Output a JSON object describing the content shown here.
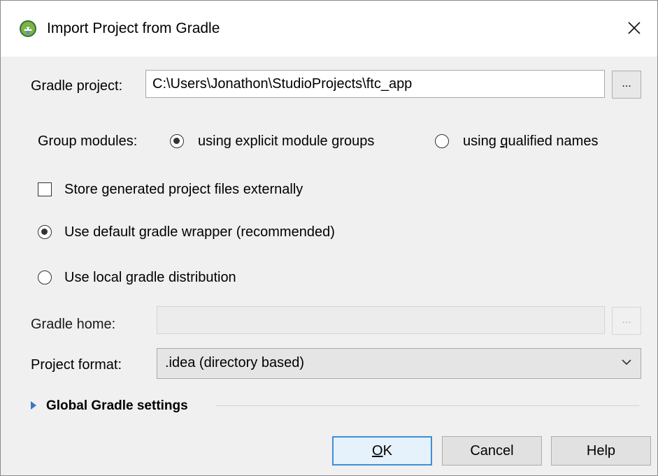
{
  "dialog": {
    "title": "Import Project from Gradle",
    "close_label": "✕"
  },
  "gradle_project": {
    "label": "Gradle project:",
    "value": "C:\\Users\\Jonathon\\StudioProjects\\ftc_app",
    "browse_label": "..."
  },
  "group_modules": {
    "label": "Group modules:",
    "options": [
      {
        "pre": "using explicit module ",
        "mnemonic": "g",
        "post": "roups",
        "selected": true
      },
      {
        "pre": "using ",
        "mnemonic": "q",
        "post": "ualified names",
        "selected": false
      }
    ]
  },
  "store_externally": {
    "label": "Store generated project files externally",
    "checked": false
  },
  "wrapper_options": [
    {
      "label": "Use default gradle wrapper (recommended)",
      "selected": true
    },
    {
      "label": "Use local gradle distribution",
      "selected": false
    }
  ],
  "gradle_home": {
    "label": "Gradle home:",
    "value": "",
    "browse_label": "..."
  },
  "project_format": {
    "label": "Project format:",
    "value": ".idea (directory based)"
  },
  "global_settings": {
    "label": "Global Gradle settings"
  },
  "buttons": {
    "ok_mnemonic": "O",
    "ok_rest": "K",
    "cancel": "Cancel",
    "help": "Help"
  },
  "colors": {
    "accent": "#3c8fd8",
    "expand_arrow": "#3a78c5",
    "android_green": "#7cb342"
  }
}
